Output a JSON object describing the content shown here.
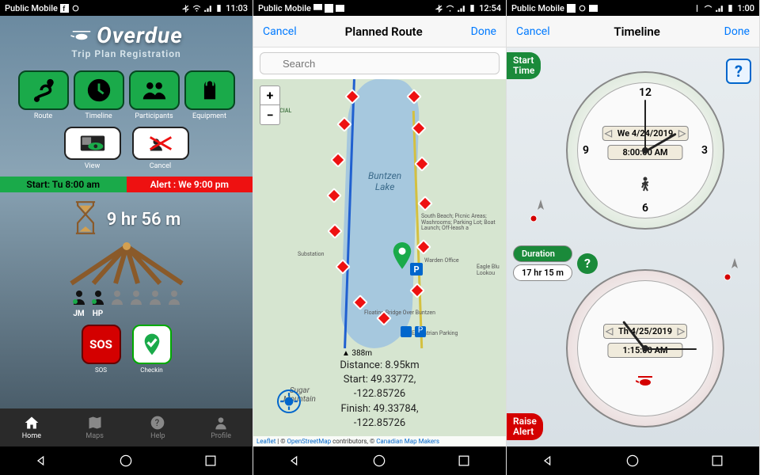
{
  "screens": {
    "s1": {
      "statusbar": {
        "carrier": "Public Mobile",
        "time": "11:03"
      },
      "logo": {
        "title": "Overdue",
        "subtitle": "Trip Plan Registration"
      },
      "mainButtons": [
        {
          "label": "Route"
        },
        {
          "label": "Timeline"
        },
        {
          "label": "Participants"
        },
        {
          "label": "Equipment"
        }
      ],
      "secondaryButtons": [
        {
          "label": "View"
        },
        {
          "label": "Cancel"
        }
      ],
      "status": {
        "start": "Start: Tu 8:00 am",
        "alert": "Alert : We 9:00 pm"
      },
      "timer": "9 hr 56 m",
      "participants": [
        {
          "initials": "JM",
          "active": true
        },
        {
          "initials": "HP",
          "active": true
        },
        {
          "initials": "",
          "active": false
        },
        {
          "initials": "",
          "active": false
        },
        {
          "initials": "",
          "active": false
        },
        {
          "initials": "",
          "active": false
        }
      ],
      "sosButtons": [
        {
          "label": "SOS",
          "text": "SOS"
        },
        {
          "label": "Checkin"
        }
      ],
      "nav": [
        {
          "label": "Home",
          "active": true
        },
        {
          "label": "Maps",
          "active": false
        },
        {
          "label": "Help",
          "active": false
        },
        {
          "label": "Profile",
          "active": false
        }
      ]
    },
    "s2": {
      "statusbar": {
        "carrier": "Public Mobile",
        "time": "12:54"
      },
      "header": {
        "cancel": "Cancel",
        "title": "Planned Route",
        "done": "Done"
      },
      "search": {
        "placeholder": "Search"
      },
      "map": {
        "lake": "Buntzen\nLake",
        "park": "PROVINCIAL\nPARK",
        "sugar": "Sugar\nMountain",
        "elev": "▲ 388m",
        "poi1": "South Beach; Picnic Areas;\nWashrooms; Parking Lot;\nBoat Launch; Off-leash a",
        "poi2": "Substation",
        "poi3": "Warden\nOffice",
        "poi4": "Floating Bridge\nOver Buntzen",
        "poi5": "Equestrian\nParking",
        "poi6": "Eagle Blu\nLookou",
        "distance": "Distance: 8.95km",
        "start": "Start: 49.33772, -122.85726",
        "finish": "Finish: 49.33784, -122.85726",
        "attrib": {
          "a1": "Leaflet",
          "a2": "OpenStreetMap",
          "a3": " contributors, © ",
          "a4": "Canadian Map Makers"
        }
      }
    },
    "s3": {
      "statusbar": {
        "carrier": "Public Mobile",
        "time": "1:00"
      },
      "header": {
        "cancel": "Cancel",
        "title": "Timeline",
        "done": "Done"
      },
      "startTag": "Start\nTime",
      "alertTag": "Raise\nAlert",
      "clock1": {
        "date": "We 4/24/2019",
        "time": "8:00:00 AM",
        "numbers": [
          "12",
          "3",
          "6",
          "9"
        ]
      },
      "clock2": {
        "date": "Th 4/25/2019",
        "time": "1:15:00 AM"
      },
      "duration": {
        "label": "Duration",
        "value": "17 hr 15 m"
      },
      "help": "?"
    }
  }
}
